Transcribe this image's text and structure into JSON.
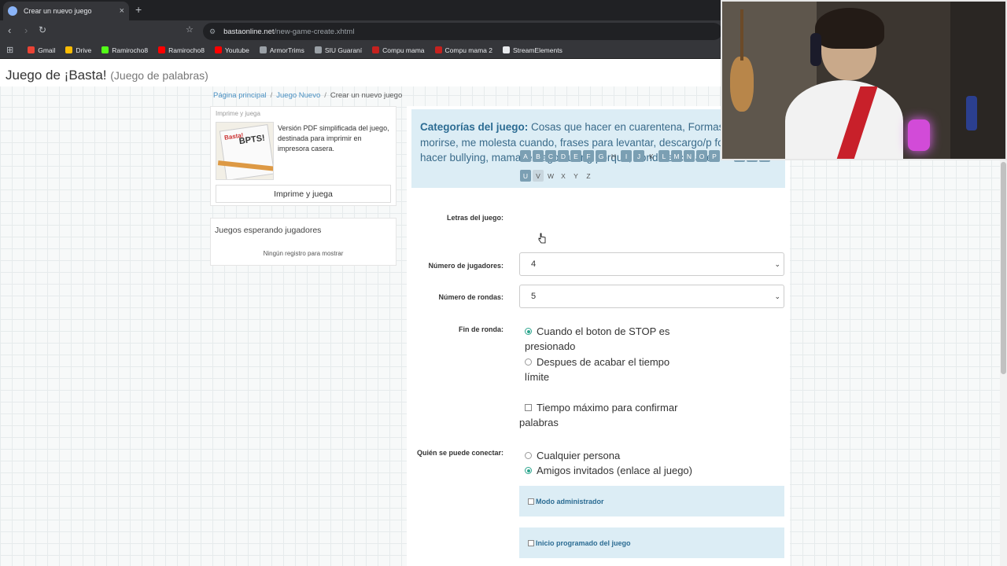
{
  "browser": {
    "tab_title": "Crear un nuevo juego",
    "new_tab": "+",
    "close_tab": "×",
    "url_host": "bastaonline.net",
    "url_path": "/new-game-create.xhtml",
    "bookmarks": [
      {
        "label": "Gmail",
        "color": "#ea4335"
      },
      {
        "label": "Drive",
        "color": "#fbbc04"
      },
      {
        "label": "Ramirocho8",
        "color": "#53fc18"
      },
      {
        "label": "Ramirocho8",
        "color": "#ff0000"
      },
      {
        "label": "Youtube",
        "color": "#ff0000"
      },
      {
        "label": "ArmorTrims",
        "color": "#9aa0a6"
      },
      {
        "label": "SIU Guaraní",
        "color": "#9aa0a6"
      },
      {
        "label": "Compu mama",
        "color": "#c5221f"
      },
      {
        "label": "Compu mama 2",
        "color": "#c5221f"
      },
      {
        "label": "StreamElements",
        "color": "#e8eaed"
      }
    ]
  },
  "site": {
    "title": "Juego de ¡Basta!",
    "subtitle": "(Juego de palabras)"
  },
  "breadcrumb": {
    "home": "Página principal",
    "sep": "/",
    "new_game": "Juego Nuevo",
    "current": "Crear un nuevo juego"
  },
  "print_panel": {
    "heading": "Imprime y juega",
    "thumb_brand": "Basta!",
    "thumb_word": "BPTS!",
    "description": "Versión PDF simplificada del juego, destinada para imprimir en impresora casera.",
    "button": "Imprime y juega"
  },
  "waiting_panel": {
    "heading": "Juegos esperando jugadores",
    "empty": "Ningún registro para mostrar"
  },
  "categories": {
    "label": "Categorías del juego:",
    "text": "Cosas que hacer en cuarentena, Formas de morirse, me molesta cuando, frases para levantar, descargo/p formas de hacer bullying, mama le hago bulling porque, donde el cadaver"
  },
  "form": {
    "letters_label": "Letras del juego:",
    "letters": [
      {
        "l": "A",
        "on": true
      },
      {
        "l": "B",
        "on": true
      },
      {
        "l": "C",
        "on": true
      },
      {
        "l": "D",
        "on": true
      },
      {
        "l": "E",
        "on": true
      },
      {
        "l": "F",
        "on": true
      },
      {
        "l": "G",
        "on": true
      },
      {
        "l": "H",
        "on": false
      },
      {
        "l": "I",
        "on": true
      },
      {
        "l": "J",
        "on": true
      },
      {
        "l": "K",
        "on": false
      },
      {
        "l": "L",
        "on": true
      },
      {
        "l": "M",
        "on": true
      },
      {
        "l": "N",
        "on": true
      },
      {
        "l": "O",
        "on": true
      },
      {
        "l": "P",
        "on": true
      },
      {
        "l": "Q",
        "on": false
      },
      {
        "l": "R",
        "on": true
      },
      {
        "l": "S",
        "on": true
      },
      {
        "l": "T",
        "on": true
      },
      {
        "l": "U",
        "on": true
      },
      {
        "l": "V",
        "on": false,
        "hover": true
      },
      {
        "l": "W",
        "on": false
      },
      {
        "l": "X",
        "on": false
      },
      {
        "l": "Y",
        "on": false
      },
      {
        "l": "Z",
        "on": false
      }
    ],
    "players_label": "Número de jugadores:",
    "players_value": "4",
    "rounds_label": "Número de rondas:",
    "rounds_value": "5",
    "round_end_label": "Fin de ronda:",
    "round_end_opt1": "Cuando el boton de STOP es presionado",
    "round_end_opt2": "Despues de acabar el tiempo límite",
    "max_time_label": "Tiempo máximo para confirmar palabras",
    "who_label": "Quién se puede conectar:",
    "who_opt1": "Cualquier persona",
    "who_opt2": "Amigos invitados (enlace al juego)",
    "admin_mode": "Modo administrador",
    "scheduled_start": "Inicio programado del juego"
  }
}
